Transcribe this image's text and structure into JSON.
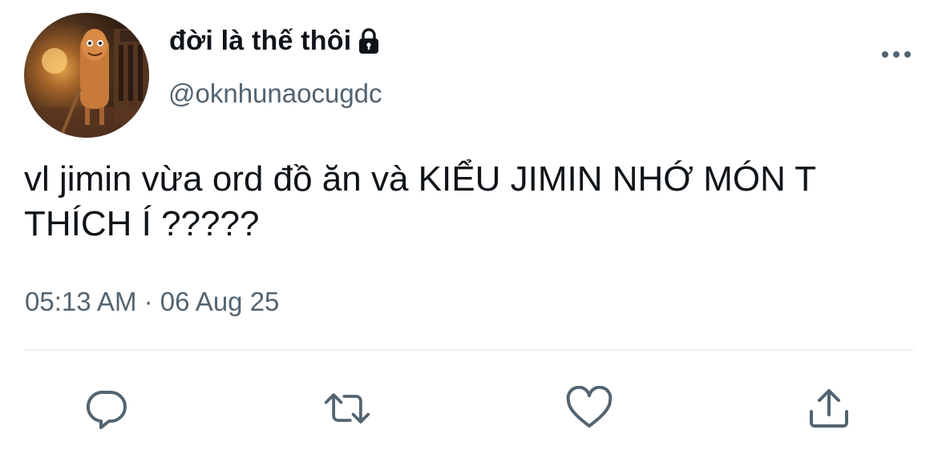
{
  "tweet": {
    "display_name": "đời là thế thôi",
    "username": "@oknhunaocugdc",
    "text": "vl jimin vừa ord đồ ăn và KIỂU JIMIN NHỚ MÓN T THÍCH Í ?????",
    "timestamp": "05:13 AM · 06 Aug 25",
    "protected": true
  },
  "icons": {
    "lock": "lock-icon",
    "more": "more-options-icon",
    "reply": "reply-icon",
    "retweet": "retweet-icon",
    "like": "heart-icon",
    "share": "share-icon"
  },
  "colors": {
    "text": "#0f1419",
    "secondary": "#536471",
    "divider": "#eff3f4"
  }
}
